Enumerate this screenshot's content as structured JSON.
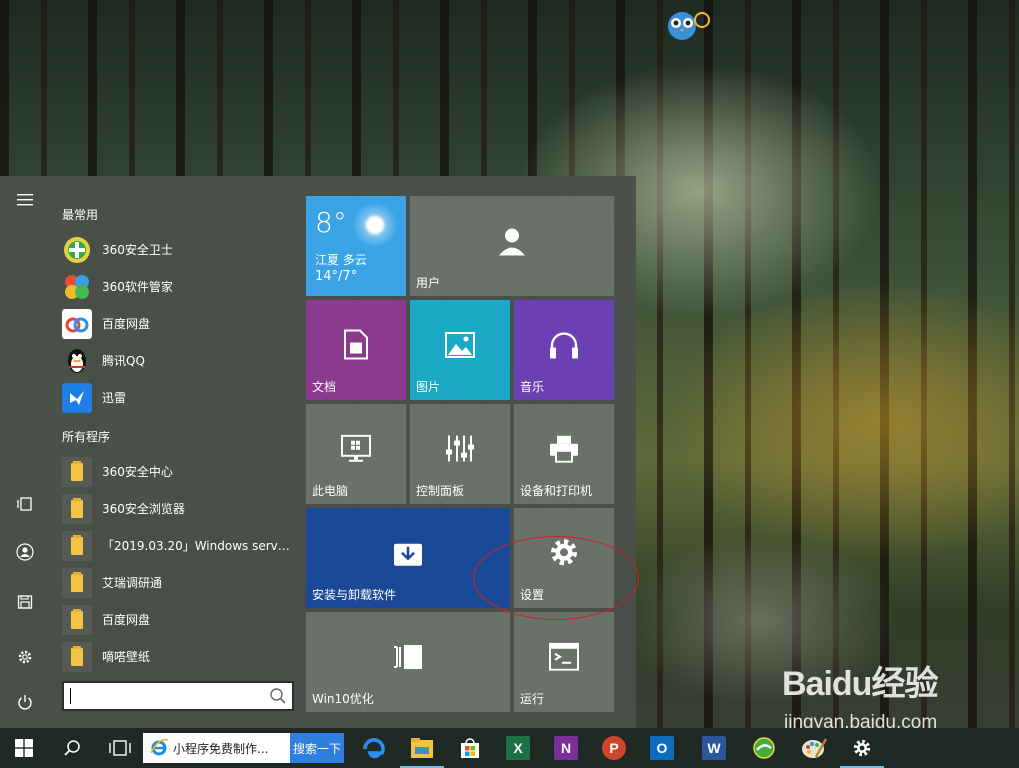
{
  "start_menu": {
    "most_used_header": "最常用",
    "most_used": [
      {
        "label": "360安全卫士",
        "icon": "360-safeguard-icon"
      },
      {
        "label": "360软件管家",
        "icon": "360-software-manager-icon"
      },
      {
        "label": "百度网盘",
        "icon": "baidu-netdisk-icon"
      },
      {
        "label": "腾讯QQ",
        "icon": "qq-penguin-icon"
      },
      {
        "label": "迅雷",
        "icon": "xunlei-bird-icon"
      }
    ],
    "all_programs_header": "所有程序",
    "all_programs": [
      {
        "label": "360安全中心",
        "icon": "folder-icon"
      },
      {
        "label": "360安全浏览器",
        "icon": "folder-icon"
      },
      {
        "label": "「2019.03.20」Windows server...",
        "icon": "folder-icon"
      },
      {
        "label": "艾瑞调研通",
        "icon": "folder-icon"
      },
      {
        "label": "百度网盘",
        "icon": "folder-icon"
      },
      {
        "label": "嘀嗒壁纸",
        "icon": "folder-icon"
      }
    ],
    "search_placeholder": "",
    "tiles": {
      "weather": {
        "temp": "8°",
        "location": "江夏 多云",
        "range": "14°/7°",
        "color": "#39a3e6"
      },
      "user": {
        "label": "用户"
      },
      "documents": {
        "label": "文档",
        "color": "#8c3a8f"
      },
      "pictures": {
        "label": "图片",
        "color": "#1ba9c6"
      },
      "music": {
        "label": "音乐",
        "color": "#6c3fb2"
      },
      "this_pc": {
        "label": "此电脑"
      },
      "control_panel": {
        "label": "控制面板"
      },
      "devices_printers": {
        "label": "设备和打印机"
      },
      "uninstall": {
        "label": "安装与卸载软件",
        "color": "#1a4a97"
      },
      "settings": {
        "label": "设置"
      },
      "win10_optimize": {
        "label": "Win10优化"
      },
      "run": {
        "label": "运行"
      }
    }
  },
  "taskbar": {
    "search_text": "小程序免费制作...",
    "search_button": "搜索一下",
    "pinned": [
      "edge-icon",
      "file-explorer-icon",
      "store-icon",
      "excel-icon",
      "onenote-icon",
      "powerpoint-icon",
      "outlook-icon",
      "word-icon",
      "360-browser-icon",
      "paint-icon",
      "settings-icon"
    ],
    "excel_letter": "X",
    "onenote_letter": "N",
    "powerpoint_letter": "P",
    "outlook_letter": "O",
    "word_letter": "W"
  },
  "watermark": {
    "title": "Baidu经验",
    "subtitle": "jingyan.baidu.com"
  }
}
